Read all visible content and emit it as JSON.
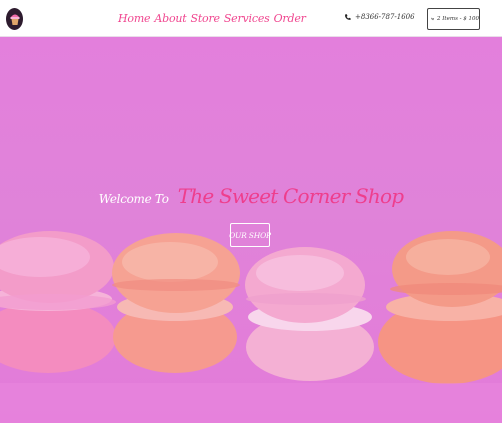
{
  "nav": {
    "logo": "cupcake-logo",
    "links": [
      "Home",
      "About",
      "Store",
      "Services",
      "Order"
    ],
    "phone": "+8366-787-1606",
    "phone_icon": "phone-icon",
    "cart_icon": "cart-icon",
    "cart_label": "2 Items - $ 100"
  },
  "hero": {
    "welcome": "Welcome To",
    "shop_name": "The Sweet Corner Shop",
    "button_label": "OUR SHOP"
  },
  "colors": {
    "accent": "#f0468f",
    "hero_overlay": "#e580dd",
    "navbar": "#ffffff"
  }
}
